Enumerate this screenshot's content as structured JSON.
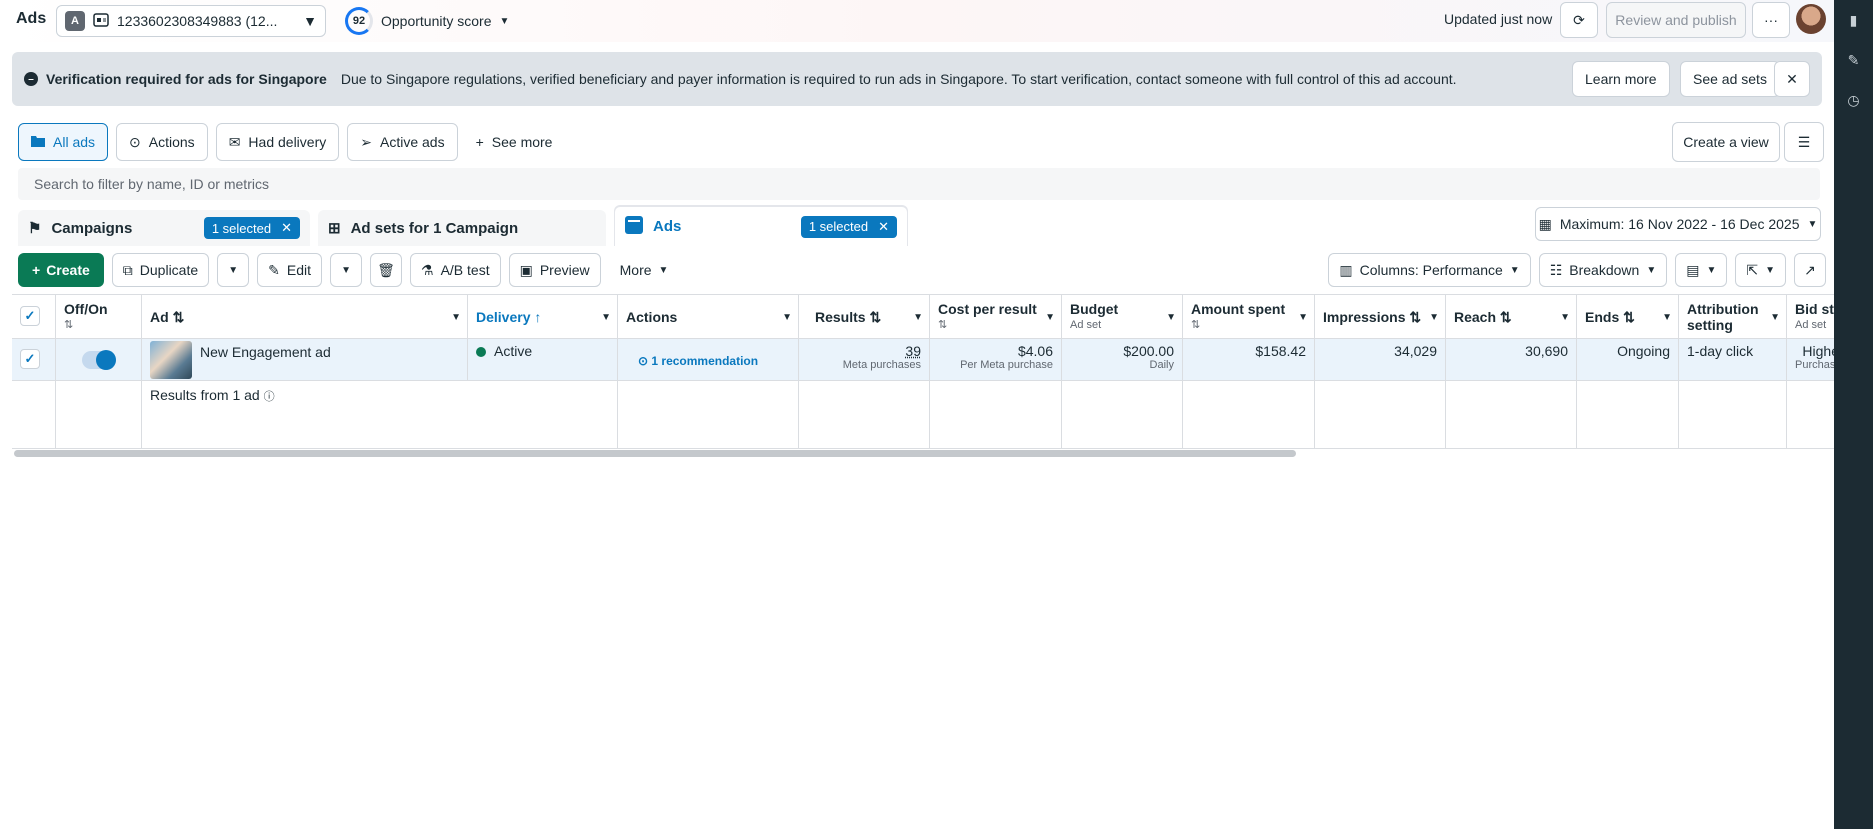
{
  "topbar": {
    "app_title": "Ads",
    "account_badge": "A",
    "account_label": "1233602308349883 (12...",
    "opportunity_score": "92",
    "opportunity_label": "Opportunity score",
    "updated": "Updated just now",
    "review_publish": "Review and publish"
  },
  "banner": {
    "title": "Verification required for ads for Singapore",
    "message": "Due to Singapore regulations, verified beneficiary and payer information is required to run ads in Singapore. To start verification, contact someone with full control of this ad account.",
    "learn_more": "Learn more",
    "see_ad_sets": "See ad sets"
  },
  "filters": {
    "all_ads": "All ads",
    "actions": "Actions",
    "had_delivery": "Had delivery",
    "active_ads": "Active ads",
    "see_more": "See more",
    "create_view": "Create a view"
  },
  "search": {
    "placeholder": "Search to filter by name, ID or metrics"
  },
  "level_tabs": {
    "campaigns": "Campaigns",
    "campaigns_selected": "1 selected",
    "ad_sets": "Ad sets for 1 Campaign",
    "ads": "Ads",
    "ads_selected": "1 selected"
  },
  "date_range": "Maximum: 16 Nov 2022 - 16 Dec 2025",
  "toolbar": {
    "create": "Create",
    "duplicate": "Duplicate",
    "edit": "Edit",
    "ab_test": "A/B test",
    "preview": "Preview",
    "more": "More",
    "columns": "Columns: Performance",
    "breakdown": "Breakdown"
  },
  "table": {
    "headers": {
      "offon": "Off/On",
      "ad": "Ad",
      "delivery": "Delivery",
      "actions": "Actions",
      "results": "Results",
      "cost_per_result": "Cost per result",
      "budget": "Budget",
      "budget_sub": "Ad set",
      "amount_spent": "Amount spent",
      "impressions": "Impressions",
      "reach": "Reach",
      "ends": "Ends",
      "attribution": "Attribution setting",
      "bid_strategy": "Bid stra",
      "bid_sub": "Ad set"
    },
    "row": {
      "ad_name": "New Engagement ad",
      "delivery": "Active",
      "actions": "1 recommendation",
      "results": "39",
      "results_sub": "Meta purchases",
      "cost_per_result": "$4.06",
      "cost_sub": "Per Meta purchase",
      "budget": "$200.00",
      "budget_sub": "Daily",
      "amount_spent": "$158.42",
      "impressions": "34,029",
      "reach": "30,690",
      "ends": "Ongoing",
      "attribution": "1-day click",
      "bid": "Highe",
      "bid_sub": "Purchase"
    },
    "footer": "Results from 1 ad"
  }
}
